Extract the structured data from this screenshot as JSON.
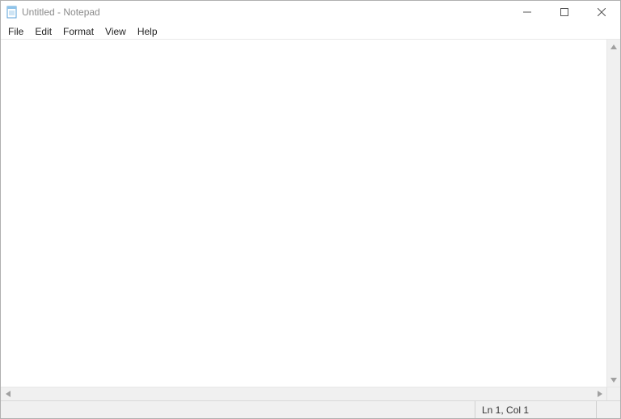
{
  "window": {
    "title": "Untitled - Notepad"
  },
  "menu": {
    "items": [
      "File",
      "Edit",
      "Format",
      "View",
      "Help"
    ]
  },
  "editor": {
    "content": ""
  },
  "status": {
    "position": "Ln 1, Col 1"
  }
}
